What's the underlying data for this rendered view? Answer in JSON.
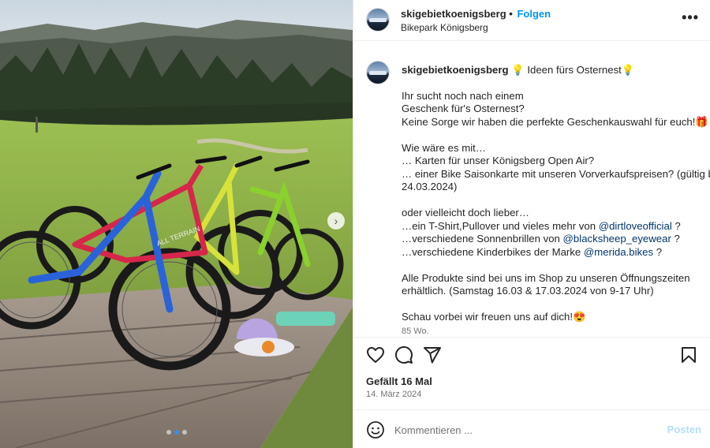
{
  "header": {
    "username": "skigebietkoenigsberg",
    "separator": "•",
    "follow_label": "Folgen",
    "location": "Bikepark Königsberg",
    "more_glyph": "•••"
  },
  "caption": {
    "username": "skigebietkoenigsberg",
    "bulb_glyph": "💡",
    "title": "Ideen fürs Osternest",
    "lines": [
      {
        "text": "Ihr sucht noch nach einem"
      },
      {
        "text": "Geschenk für's Osternest?"
      },
      {
        "text": "Keine Sorge wir haben die perfekte Geschenkauswahl für euch!",
        "suffix": "🎁"
      },
      {
        "text": ""
      },
      {
        "text": "Wie wäre es mit…"
      },
      {
        "text": "… Karten für unser Königsberg Open Air?"
      },
      {
        "text": "… einer Bike Saisonkarte mit unseren Vorverkaufspreisen? (gültig bis"
      },
      {
        "text": "24.03.2024)"
      },
      {
        "text": ""
      },
      {
        "text": "oder vielleicht doch lieber…"
      },
      {
        "text": "…ein T-Shirt,Pullover und vieles mehr von ",
        "mention": "@dirtloveofficial",
        "after": " ?"
      },
      {
        "text": "…verschiedene Sonnenbrillen von ",
        "mention": "@blacksheep_eyewear",
        "after": " ?"
      },
      {
        "text": "…verschiedene Kinderbikes der Marke ",
        "mention": "@merida.bikes",
        "after": " ?"
      },
      {
        "text": ""
      },
      {
        "text": "Alle Produkte sind bei uns im Shop zu unseren Öffnungszeiten"
      },
      {
        "text": "erhältlich. (Samstag 16.03 & 17.03.2024 von 9-17 Uhr)"
      },
      {
        "text": ""
      },
      {
        "text": "Schau vorbei wir freuen uns auf dich!",
        "suffix": "😍"
      }
    ],
    "time_ago": "85 Wo."
  },
  "actions": {
    "icons": [
      "heart-icon",
      "comment-icon",
      "share-icon",
      "bookmark-icon"
    ]
  },
  "likes": "Gefällt 16 Mal",
  "date": "14. März 2024",
  "comment": {
    "placeholder": "Kommentieren ...",
    "post_label": "Posten"
  },
  "photo": {
    "next_glyph": "›",
    "frame_label": "ALL TERRAIN",
    "slide_count": 3,
    "active_slide": 1
  },
  "colors": {
    "accent": "#0095f6",
    "mention": "#00376b",
    "post_disabled": "#b2dffc",
    "muted": "#737373"
  }
}
